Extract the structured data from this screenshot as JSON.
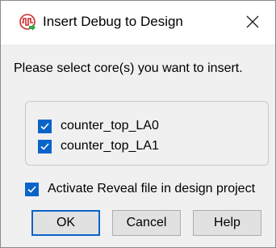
{
  "window": {
    "title": "Insert Debug to Design",
    "icon": "reveal-debug-icon",
    "close_icon": "close-icon"
  },
  "prompt": "Please select core(s) you want to insert.",
  "cores": [
    {
      "label": "counter_top_LA0",
      "checked": true
    },
    {
      "label": "counter_top_LA1",
      "checked": true
    }
  ],
  "activate_reveal": {
    "label": "Activate Reveal file in design project",
    "checked": true
  },
  "buttons": {
    "ok": "OK",
    "cancel": "Cancel",
    "help": "Help"
  },
  "colors": {
    "checkbox_fill": "#0a64c8",
    "dialog_bg": "#f0f0f0",
    "title_bg": "#ffffff"
  }
}
